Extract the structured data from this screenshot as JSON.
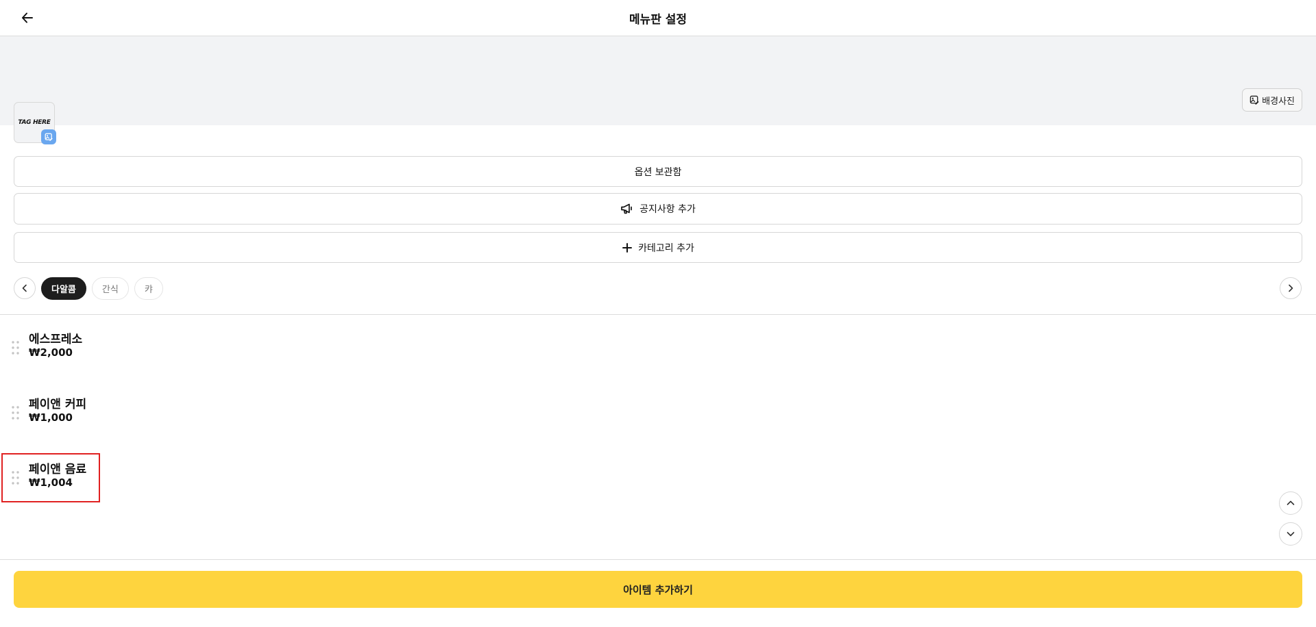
{
  "header": {
    "title": "메뉴판 설정"
  },
  "banner": {
    "bg_photo_label": "배경사진",
    "logo_text": "TAG HERE"
  },
  "actions": {
    "options_label": "옵션 보관함",
    "notice_label": "공지사항 추가",
    "category_label": "카테고리 추가"
  },
  "categories": [
    {
      "label": "다알콤",
      "active": true
    },
    {
      "label": "간식",
      "active": false
    },
    {
      "label": "캬",
      "active": false
    }
  ],
  "items": [
    {
      "name": "에스프레소",
      "price": "₩2,000"
    },
    {
      "name": "페이앤 커피",
      "price": "₩1,000"
    },
    {
      "name": "페이앤 음료",
      "price": "₩1,004"
    }
  ],
  "footer": {
    "add_item_label": "아이템 추가하기"
  },
  "colors": {
    "accent": "#fed43e",
    "active_chip": "#1d1d1d",
    "logo_edit": "#6aa7ef",
    "highlight": "#e02020"
  }
}
